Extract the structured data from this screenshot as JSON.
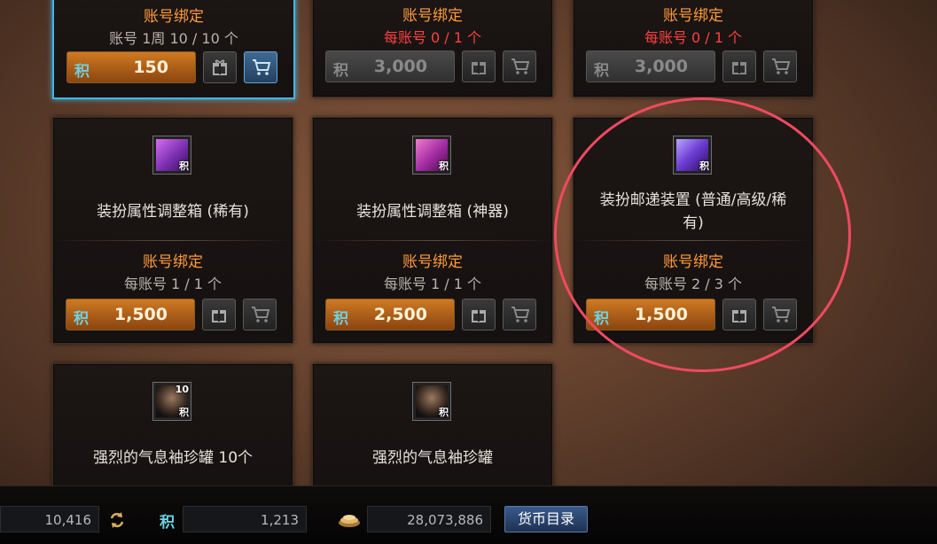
{
  "cards": [
    {
      "bind": "账号绑定",
      "limit": "账号 1周 10 / 10 个",
      "limit_red": false,
      "currency": "积",
      "price": "150",
      "price_disabled": false
    },
    {
      "bind": "账号绑定",
      "limit": "每账号 0 / 1 个",
      "limit_red": true,
      "currency": "积",
      "price": "3,000",
      "price_disabled": true
    },
    {
      "bind": "账号绑定",
      "limit": "每账号 0 / 1 个",
      "limit_red": true,
      "currency": "积",
      "price": "3,000",
      "price_disabled": true
    },
    {
      "name": "装扮属性调整箱 (稀有)",
      "icon_tag": "积",
      "bind": "账号绑定",
      "limit": "每账号 1 / 1 个",
      "currency": "积",
      "price": "1,500"
    },
    {
      "name": "装扮属性调整箱 (神器)",
      "icon_tag": "积",
      "bind": "账号绑定",
      "limit": "每账号 1 / 1 个",
      "currency": "积",
      "price": "2,500"
    },
    {
      "name": "装扮邮递装置 (普通/高级/稀有)",
      "icon_tag": "积",
      "bind": "账号绑定",
      "limit": "每账号 2 / 3 个",
      "currency": "积",
      "price": "1,500"
    },
    {
      "name": "强烈的气息袖珍罐 10个",
      "icon_tag": "积",
      "icon_count": "10"
    },
    {
      "name": "强烈的气息袖珍罐",
      "icon_tag": "积"
    }
  ],
  "bottom": {
    "value1": "10,416",
    "points_label": "积",
    "points": "1,213",
    "gold": "28,073,886",
    "currency_button": "货币目录"
  },
  "colors": {
    "bind": "#ff9a3a",
    "limit_red": "#ff4040",
    "selected_border": "#3fb7e8",
    "annotation_circle": "#f04a60"
  }
}
